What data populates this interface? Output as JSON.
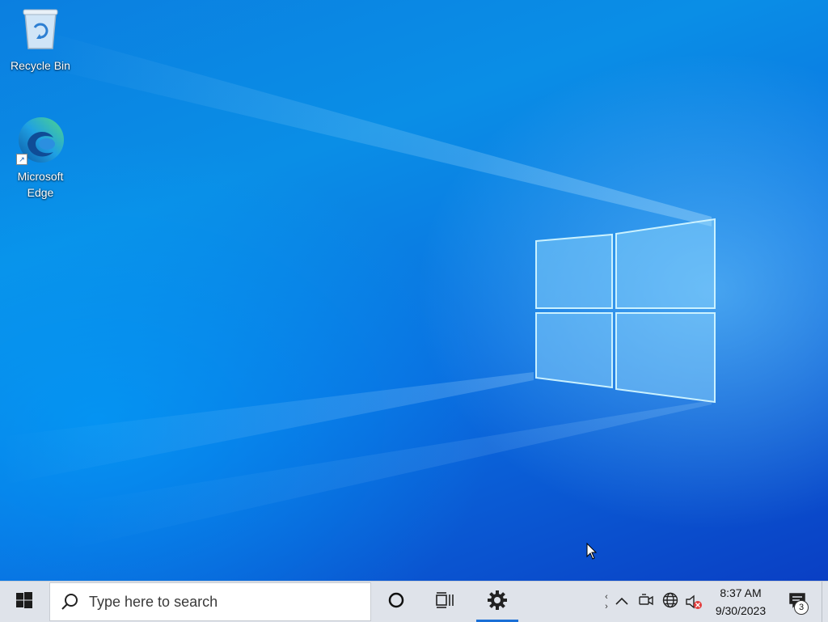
{
  "desktop": {
    "icons": [
      {
        "label": "Recycle Bin",
        "icon": "recycle-bin-icon"
      },
      {
        "label": "Microsoft Edge",
        "icon": "edge-icon",
        "shortcut": true
      }
    ]
  },
  "taskbar": {
    "start_icon": "windows-logo-icon",
    "search": {
      "placeholder": "Type here to search",
      "icon": "search-icon"
    },
    "cortana_icon": "cortana-icon",
    "task_view_icon": "task-view-icon",
    "pinned_apps": [
      {
        "name": "Settings",
        "icon": "gear-icon",
        "active": true
      }
    ],
    "tray": {
      "icons": [
        "chevron-up-icon",
        "meet-now-icon",
        "network-globe-icon",
        "volume-muted-icon"
      ],
      "time": "8:37 AM",
      "date": "9/30/2023",
      "notification_count": "3"
    }
  },
  "colors": {
    "accent": "#1a6fd6",
    "taskbar_bg": "#dfe3ea",
    "desktop_bg": "#0a63d8"
  }
}
